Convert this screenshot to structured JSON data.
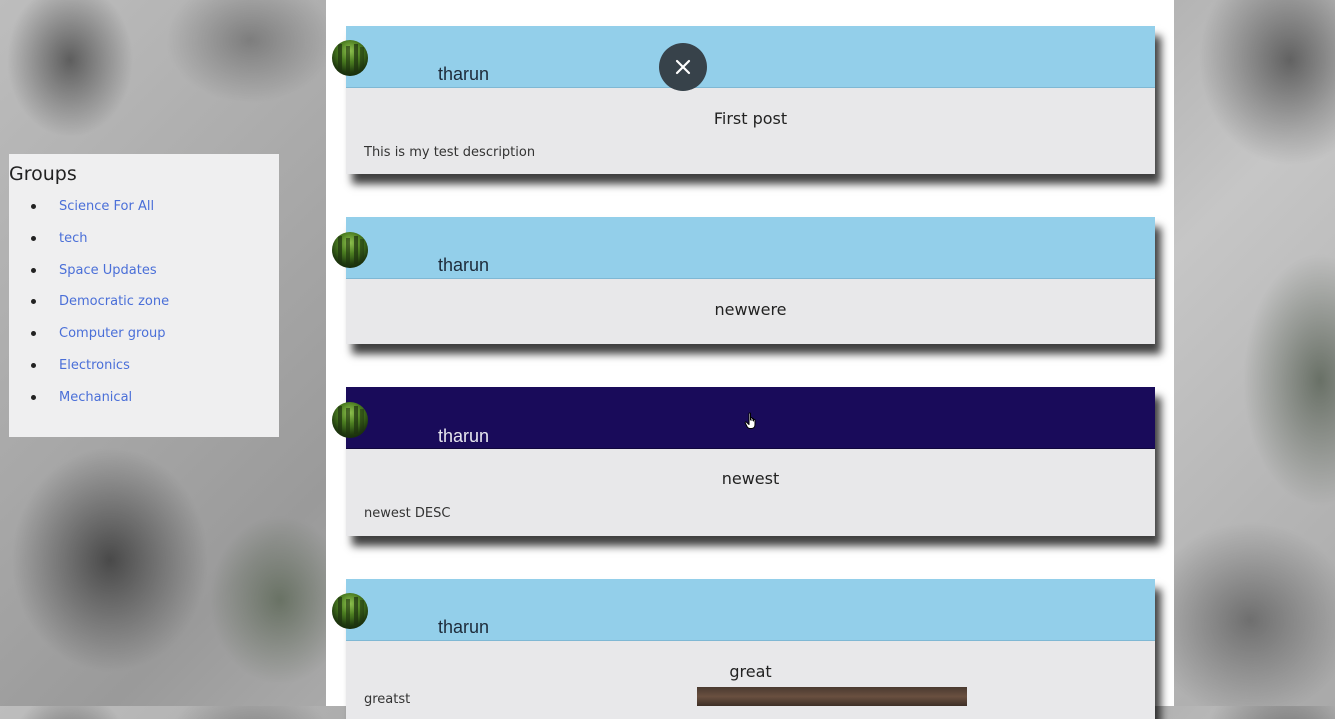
{
  "groups": {
    "title": "Groups",
    "items": [
      {
        "label": "Science For All"
      },
      {
        "label": "tech"
      },
      {
        "label": "Space Updates"
      },
      {
        "label": "Democratic zone"
      },
      {
        "label": "Computer group"
      },
      {
        "label": "Electronics"
      },
      {
        "label": "Mechanical"
      }
    ]
  },
  "posts": [
    {
      "author": "tharun",
      "title": "First post",
      "description": "This is my test description"
    },
    {
      "author": "tharun",
      "title": "newwere",
      "description": ""
    },
    {
      "author": "tharun",
      "title": "newest",
      "description": "newest DESC"
    },
    {
      "author": "tharun",
      "title": "great",
      "description": "greatst"
    }
  ],
  "colors": {
    "header_light": "#93cfea",
    "header_active": "#190b5a",
    "link": "#4a6fd8",
    "close_button": "#37424a"
  },
  "icons": {
    "close": "close-icon",
    "cursor": "hand-pointer-icon",
    "avatar": "avatar"
  }
}
